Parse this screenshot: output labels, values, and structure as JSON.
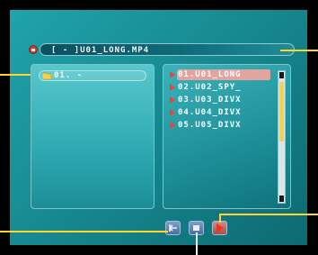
{
  "path": {
    "text": "[ - ]U01_LONG.MP4"
  },
  "folder_panel": {
    "items": [
      {
        "label": "01. -",
        "icon": "folder-icon"
      }
    ]
  },
  "file_panel": {
    "items": [
      {
        "label": "01.U01_LONG",
        "selected": true
      },
      {
        "label": "02.U02_SPY_"
      },
      {
        "label": "03.U03_DIVX"
      },
      {
        "label": "04.U04_DIVX"
      },
      {
        "label": "05.U05_DIVX"
      }
    ],
    "scroll_position": 0.0
  },
  "controls": {
    "buttons": [
      {
        "name": "back-button",
        "icon": "back-arrow-icon"
      },
      {
        "name": "stop-button",
        "icon": "stop-icon"
      },
      {
        "name": "play-button",
        "icon": "play-icon"
      }
    ]
  },
  "colors": {
    "accent": "#ffd52e",
    "background": "#178a91",
    "selection": "#e3a39e",
    "marker": "#ff3b30"
  }
}
